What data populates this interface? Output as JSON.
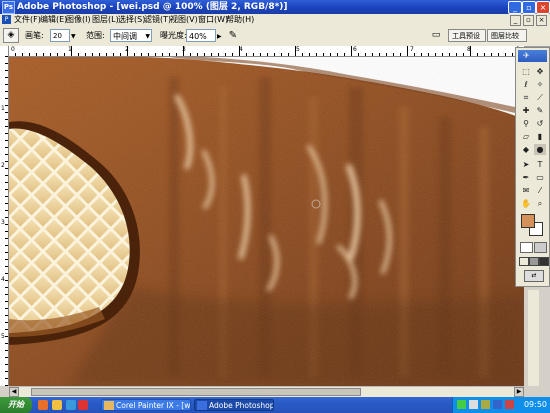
{
  "window": {
    "title": "Adobe Photoshop - [wei.psd @ 100% (图层 2, RGB/8*)]",
    "app_icon": "Ps"
  },
  "menu": {
    "items": [
      "文件(F)",
      "编辑(E)",
      "图像(I)",
      "图层(L)",
      "选择(S)",
      "滤镜(T)",
      "视图(V)",
      "窗口(W)",
      "帮助(H)"
    ]
  },
  "options": {
    "brush_label": "画笔:",
    "brush_size": "20",
    "range_label": "范围:",
    "range_value": "中间调",
    "exposure_label": "曝光度:",
    "exposure_value": "40%",
    "tab_toolpreset": "工具预设",
    "tab_layercomp": "图层比较"
  },
  "ruler": {
    "top_labels": [
      "0",
      "1",
      "2",
      "3",
      "4",
      "5",
      "6",
      "7",
      "8",
      "9"
    ],
    "left_labels": [
      "1",
      "2",
      "3",
      "4",
      "5"
    ]
  },
  "taskbar": {
    "start_label": "开始",
    "task1": "Corel Painter IX - [wei.ps...",
    "task2": "Adobe Photoshop - [wei...",
    "clock": "09:50"
  },
  "colors": {
    "titlebar": "#1941b8",
    "chocolate": "#8a4718",
    "chocolate_dark": "#5a2a0c",
    "cone": "#f0d9a6",
    "foreground_swatch": "#d4915a",
    "background_swatch": "#ffffff"
  }
}
